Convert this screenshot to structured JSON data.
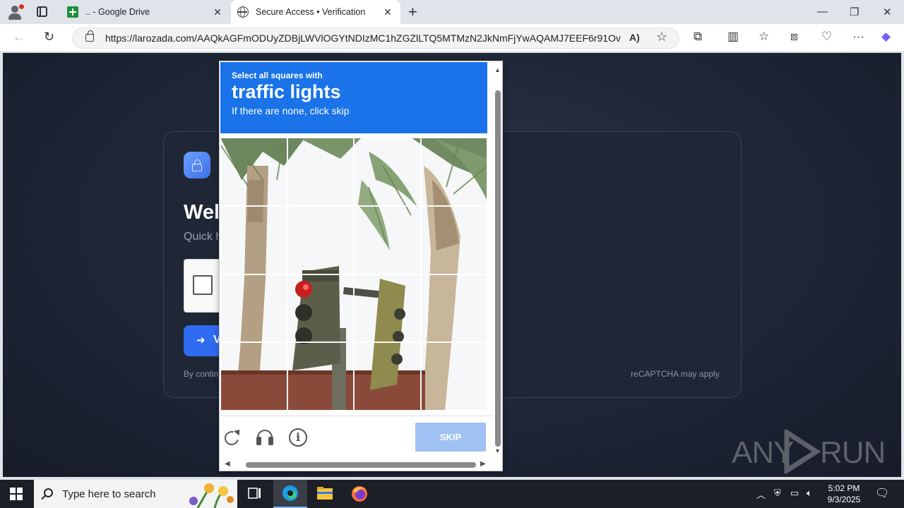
{
  "browser": {
    "tabs": [
      {
        "title": ".. - Google Drive",
        "favicon": "google-sheets-icon"
      },
      {
        "title": "Secure Access • Verification",
        "favicon": "globe-icon",
        "active": true
      }
    ],
    "url": "https://larozada.com/AAQkAGFmODUyZDBjLWVlOGYtNDIzMC1hZGZlLTQ5MTMzN2JkNmFjYwAQAMJ7EEF6r91Ovo..."
  },
  "page": {
    "card_title": "Wel",
    "card_subtitle": "Quick h",
    "verify_label": "V",
    "footer_left": "By contin",
    "footer_right": "reCAPTCHA may apply."
  },
  "captcha": {
    "instruction": "Select all squares with",
    "target": "traffic lights",
    "hint": "If there are none, click skip",
    "skip_label": "SKIP",
    "skip_color": "#9fc1f3",
    "header_color": "#1a73e8"
  },
  "watermark": {
    "left": "ANY",
    "right": "RUN"
  },
  "taskbar": {
    "search_placeholder": "Type here to search",
    "time": "5:02 PM",
    "date": "9/3/2025"
  }
}
